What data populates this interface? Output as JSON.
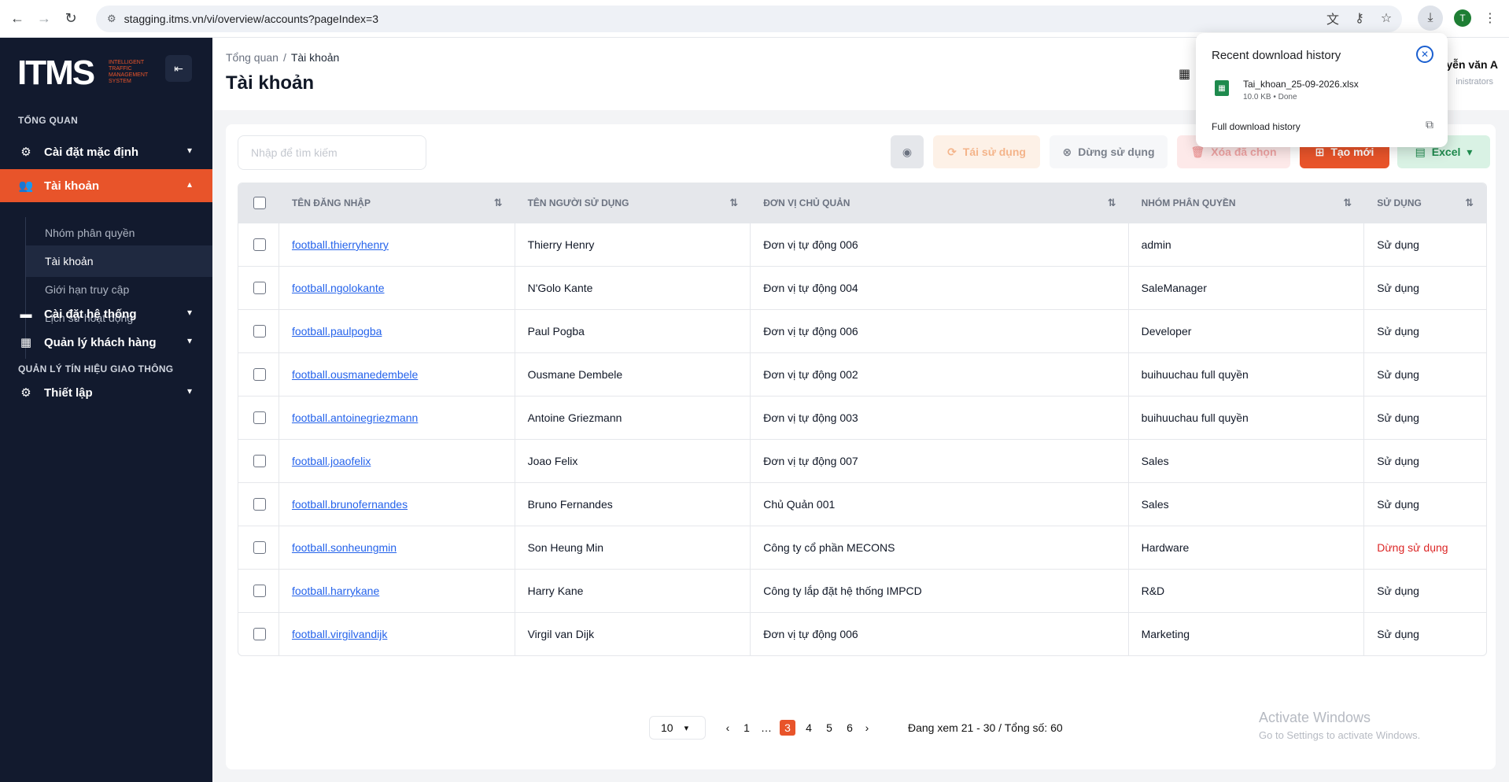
{
  "browser": {
    "url": "stagging.itms.vn/vi/overview/accounts?pageIndex=3",
    "profile_initial": "T"
  },
  "sidebar": {
    "logo": "ITMS",
    "logo_sub": "INTELLIGENT TRAFFIC MANAGEMENT SYSTEM",
    "section_overview": "TỔNG QUAN",
    "menu_default": "Cài đặt mặc định",
    "menu_accounts": "Tài khoản",
    "sub_items": [
      "Nhóm phân quyền",
      "Tài khoản",
      "Giới hạn truy cập",
      "Lịch sử hoạt động"
    ],
    "menu_system": "Cài đặt hệ thống",
    "menu_customers": "Quản lý khách hàng",
    "section_traffic": "QUẢN LÝ TÍN HIỆU GIAO THÔNG",
    "menu_setup": "Thiết lập"
  },
  "header": {
    "breadcrumb_root": "Tổng quan",
    "breadcrumb_current": "Tài khoản",
    "title": "Tài khoản",
    "user_name": "yễn văn A",
    "user_role": "inistrators"
  },
  "toolbar": {
    "search_placeholder": "Nhập để tìm kiếm",
    "reuse_label": "Tái sử dụng",
    "stop_label": "Dừng sử dụng",
    "delete_label": "Xóa đã chọn",
    "create_label": "Tạo mới",
    "excel_label": "Excel"
  },
  "table": {
    "columns": [
      "TÊN ĐĂNG NHẬP",
      "TÊN NGƯỜI SỬ DỤNG",
      "ĐƠN VỊ CHỦ QUẢN",
      "NHÓM PHÂN QUYỀN",
      "SỬ DỤNG"
    ],
    "rows": [
      {
        "username": "football.thierryhenry",
        "name": "Thierry Henry",
        "unit": "Đơn vị tự động 006",
        "group": "admin",
        "status": "Sử dụng"
      },
      {
        "username": "football.ngolokante",
        "name": "N'Golo Kante",
        "unit": "Đơn vị tự động 004",
        "group": "SaleManager",
        "status": "Sử dụng"
      },
      {
        "username": "football.paulpogba",
        "name": "Paul Pogba",
        "unit": "Đơn vị tự động 006",
        "group": "Developer",
        "status": "Sử dụng"
      },
      {
        "username": "football.ousmanedembele",
        "name": "Ousmane Dembele",
        "unit": "Đơn vị tự động 002",
        "group": "buihuuchau full quyền",
        "status": "Sử dụng"
      },
      {
        "username": "football.antoinegriezmann",
        "name": "Antoine Griezmann",
        "unit": "Đơn vị tự động 003",
        "group": "buihuuchau full quyền",
        "status": "Sử dụng"
      },
      {
        "username": "football.joaofelix",
        "name": "Joao Felix",
        "unit": "Đơn vị tự động 007",
        "group": "Sales",
        "status": "Sử dụng"
      },
      {
        "username": "football.brunofernandes",
        "name": "Bruno Fernandes",
        "unit": "Chủ Quản 001",
        "group": "Sales",
        "status": "Sử dụng"
      },
      {
        "username": "football.sonheungmin",
        "name": "Son Heung Min",
        "unit": "Công ty cổ phần MECONS",
        "group": "Hardware",
        "status": "Dừng sử dụng"
      },
      {
        "username": "football.harrykane",
        "name": "Harry Kane",
        "unit": "Công ty lắp đặt hệ thống IMPCD",
        "group": "R&D",
        "status": "Sử dụng"
      },
      {
        "username": "football.virgilvandijk",
        "name": "Virgil van Dijk",
        "unit": "Đơn vị tự động 006",
        "group": "Marketing",
        "status": "Sử dụng"
      }
    ]
  },
  "pagination": {
    "page_size": "10",
    "pages": [
      "1",
      "…",
      "3",
      "4",
      "5",
      "6"
    ],
    "current": "3",
    "info": "Đang xem 21 - 30 / Tổng số: 60"
  },
  "watermark": {
    "line1": "Activate Windows",
    "line2": "Go to Settings to activate Windows."
  },
  "download_popup": {
    "title": "Recent download history",
    "file_name": "Tai_khoan_25-09-2026.xlsx",
    "file_meta": "10.0 KB • Done",
    "full_history": "Full download history"
  },
  "colors": {
    "sidebar_bg": "#121a2e",
    "accent": "#e8542a",
    "link": "#2563eb",
    "status_stop": "#dc2626"
  }
}
